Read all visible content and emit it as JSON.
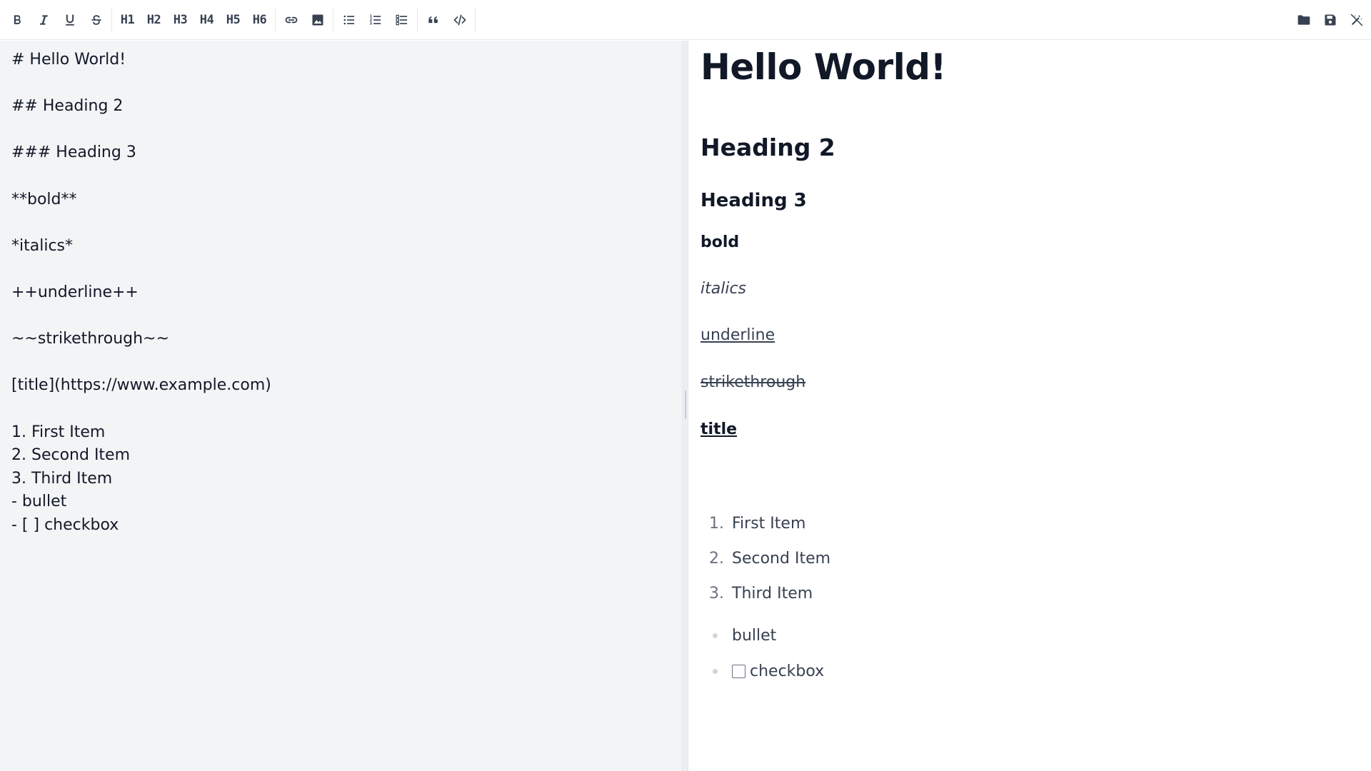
{
  "toolbar": {
    "headings": [
      "H1",
      "H2",
      "H3",
      "H4",
      "H5",
      "H6"
    ],
    "icons_left": [
      "bold-icon",
      "italic-icon",
      "underline-icon",
      "strikethrough-icon",
      "link-icon",
      "image-icon",
      "bullet-list-icon",
      "numbered-list-icon",
      "checklist-icon",
      "quote-icon",
      "code-icon"
    ],
    "icons_right": [
      "folder-open-icon",
      "save-icon",
      "magic-wand-off-icon"
    ],
    "icon_color": "#374151"
  },
  "editor": {
    "lines": [
      "# Hello World!",
      "",
      "## Heading 2",
      "",
      "### Heading 3",
      "",
      "**bold**",
      "",
      "*italics*",
      "",
      "++underline++",
      "",
      "~~strikethrough~~",
      "",
      "[title](https://www.example.com)",
      "",
      "1. First Item",
      "2. Second Item",
      "3. Third Item",
      "- bullet",
      "- [ ] checkbox"
    ],
    "background": "#f3f4f6"
  },
  "preview": {
    "h1": "Hello World!",
    "h2": "Heading 2",
    "h3": "Heading 3",
    "bold": "bold",
    "italic": "italics",
    "underline": "underline",
    "strike": "strikethrough",
    "link_text": "title",
    "ordered": [
      {
        "num": "1.",
        "text": "First Item"
      },
      {
        "num": "2.",
        "text": "Second Item"
      },
      {
        "num": "3.",
        "text": "Third Item"
      }
    ],
    "bullet": "bullet",
    "checkbox_label": "checkbox",
    "checkbox_checked": false
  }
}
